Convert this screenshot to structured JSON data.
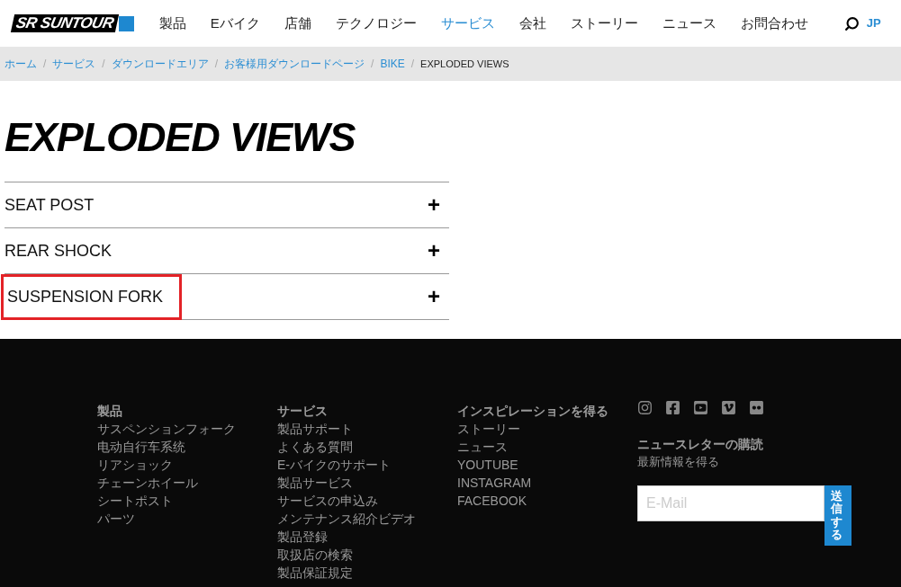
{
  "header": {
    "logo": "SR SUNTOUR",
    "nav": [
      {
        "label": "製品",
        "selected": false
      },
      {
        "label": "Eバイク",
        "selected": false
      },
      {
        "label": "店舗",
        "selected": false
      },
      {
        "label": "テクノロジー",
        "selected": false
      },
      {
        "label": "サービス",
        "selected": true
      },
      {
        "label": "会社",
        "selected": false
      },
      {
        "label": "ストーリー",
        "selected": false
      },
      {
        "label": "ニュース",
        "selected": false
      },
      {
        "label": "お問合わせ",
        "selected": false
      }
    ],
    "language": "JP"
  },
  "breadcrumb_separator": "/",
  "breadcrumb": [
    "ホーム",
    "サービス",
    "ダウンロードエリア",
    "お客様用ダウンロードページ",
    "BIKE",
    "EXPLODED VIEWS"
  ],
  "title": "EXPLODED VIEWS",
  "accordion": [
    {
      "label": "SEAT POST",
      "expanded": false,
      "highlighted": false
    },
    {
      "label": "REAR SHOCK",
      "expanded": false,
      "highlighted": false
    },
    {
      "label": "SUSPENSION FORK",
      "expanded": false,
      "highlighted": true
    }
  ],
  "expand_symbol": "+",
  "footer": {
    "columns": [
      {
        "heading": "製品",
        "links": [
          "サスペンションフォーク",
          "电动自行车系统",
          "リアショック",
          "チェーンホイール",
          "シートポスト",
          "パーツ"
        ]
      },
      {
        "heading": "サービス",
        "links": [
          "製品サポート",
          "よくある質問",
          "E-バイクのサポート",
          "製品サービス",
          "サービスの申込み",
          "メンテナンス紹介ビデオ",
          "製品登録",
          "取扱店の検索",
          "製品保証規定"
        ]
      },
      {
        "heading": "インスピレーションを得る",
        "links": [
          "ストーリー",
          "ニュース",
          "YOUTUBE",
          "INSTAGRAM",
          "FACEBOOK"
        ]
      }
    ],
    "social": [
      {
        "kind": "instagram"
      },
      {
        "kind": "facebook"
      },
      {
        "kind": "youtube"
      },
      {
        "kind": "vimeo"
      },
      {
        "kind": "flickr"
      }
    ],
    "newsletter": {
      "heading": "ニュースレターの購読",
      "subtitle": "最新情報を得る",
      "placeholder": "E-Mail",
      "button": "送信する"
    }
  }
}
